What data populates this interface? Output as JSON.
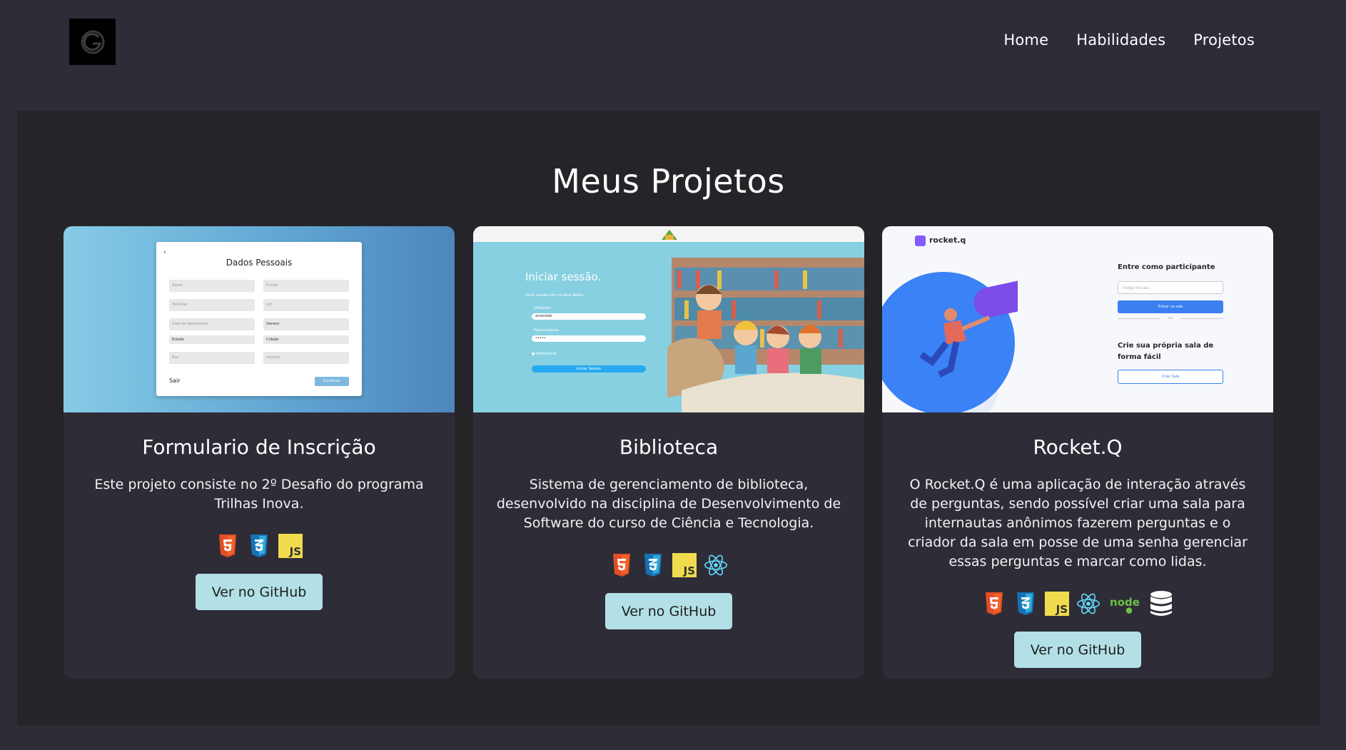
{
  "header": {
    "logo_letter": "G",
    "nav": [
      "Home",
      "Habilidades",
      "Projetos"
    ]
  },
  "section": {
    "title": "Meus Projetos"
  },
  "projects": [
    {
      "title": "Formulario de Inscrição",
      "description": "Este projeto consiste no 2º Desafio do programa Trilhas Inova.",
      "techs": [
        "html5-icon",
        "css3-icon",
        "javascript-icon"
      ],
      "button": "Ver no GitHub",
      "screenshot": {
        "back": "‹",
        "heading": "Dados Pessoais",
        "fields": [
          "Nome",
          "E-mail",
          "Telefone",
          "cpf",
          "Data de Nascimento",
          "Genero",
          "Estado",
          "Cidade",
          "Rua",
          "número"
        ],
        "exit": "Sair",
        "continue": "Continuar"
      }
    },
    {
      "title": "Biblioteca",
      "description": "Sistema de gerenciamento de biblioteca, desenvolvido na disciplina de Desenvolvimento de Software do curso de Ciência e Tecnologia.",
      "techs": [
        "html5-icon",
        "css3-icon",
        "javascript-icon",
        "react-icon"
      ],
      "button": "Ver no GitHub",
      "screenshot": {
        "heading": "Iniciar sessão.",
        "subheading": "Inicie sessão com os seus dados.",
        "user_label": "Utilizador",
        "user_value": "amandab",
        "pass_label": "Palavra-passe",
        "pass_value": "•••••",
        "admin_label": "Administrar",
        "login_button": "Iniciar Sessão"
      }
    },
    {
      "title": "Rocket.Q",
      "description": "O Rocket.Q é uma aplicação de interação através de perguntas, sendo possível criar uma sala para internautas anônimos fazerem perguntas e o criador da sala em posse de uma senha gerenciar essas perguntas e marcar como lidas.",
      "techs": [
        "html5-icon",
        "css3-icon",
        "javascript-icon",
        "react-icon",
        "nodejs-icon",
        "database-icon"
      ],
      "button": "Ver no GitHub",
      "screenshot": {
        "logo": "rocket.q",
        "heading": "Entre como participante",
        "room_placeholder": "Código da sala",
        "enter_button": "Entrar na sala",
        "or": "ou",
        "create_heading": "Crie sua própria sala de forma fácil",
        "create_button": "Criar Sala"
      }
    }
  ],
  "colors": {
    "page_bg": "#2e2c36",
    "section_bg": "#252428",
    "card_bg": "#2e2c36",
    "button_bg": "#b2e0e6",
    "html5": "#e44d26",
    "css3": "#2965f1",
    "js": "#f0db4f",
    "react": "#61dafb"
  }
}
